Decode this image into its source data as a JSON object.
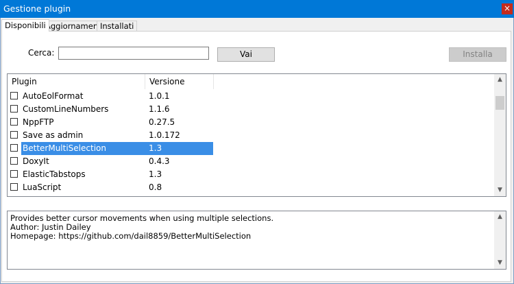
{
  "window": {
    "title": "Gestione plugin",
    "close_glyph": "×"
  },
  "tabs": [
    {
      "label": "Disponibili",
      "active": true
    },
    {
      "label": "Aggiornamenti",
      "active": false
    },
    {
      "label": "Installati",
      "active": false
    }
  ],
  "search": {
    "label": "Cerca:",
    "value": "",
    "go_label": "Vai",
    "install_label": "Installa"
  },
  "list": {
    "columns": [
      "Plugin",
      "Versione"
    ],
    "rows": [
      {
        "name": "AutoEolFormat",
        "version": "1.0.1",
        "checked": false,
        "selected": false
      },
      {
        "name": "CustomLineNumbers",
        "version": "1.1.6",
        "checked": false,
        "selected": false
      },
      {
        "name": "NppFTP",
        "version": "0.27.5",
        "checked": false,
        "selected": false
      },
      {
        "name": "Save as admin",
        "version": "1.0.172",
        "checked": false,
        "selected": false
      },
      {
        "name": "BetterMultiSelection",
        "version": "1.3",
        "checked": false,
        "selected": true
      },
      {
        "name": "DoxyIt",
        "version": "0.4.3",
        "checked": false,
        "selected": false
      },
      {
        "name": "ElasticTabstops",
        "version": "1.3",
        "checked": false,
        "selected": false
      },
      {
        "name": "LuaScript",
        "version": "0.8",
        "checked": false,
        "selected": false
      }
    ]
  },
  "description": {
    "lines": [
      "Provides better cursor movements when using multiple selections.",
      "Author: Justin Dailey",
      "Homepage: https://github.com/dail8859/BetterMultiSelection"
    ]
  },
  "colors": {
    "titlebar": "#0078d7",
    "selection": "#3a8ee6",
    "close": "#c42b1c"
  }
}
